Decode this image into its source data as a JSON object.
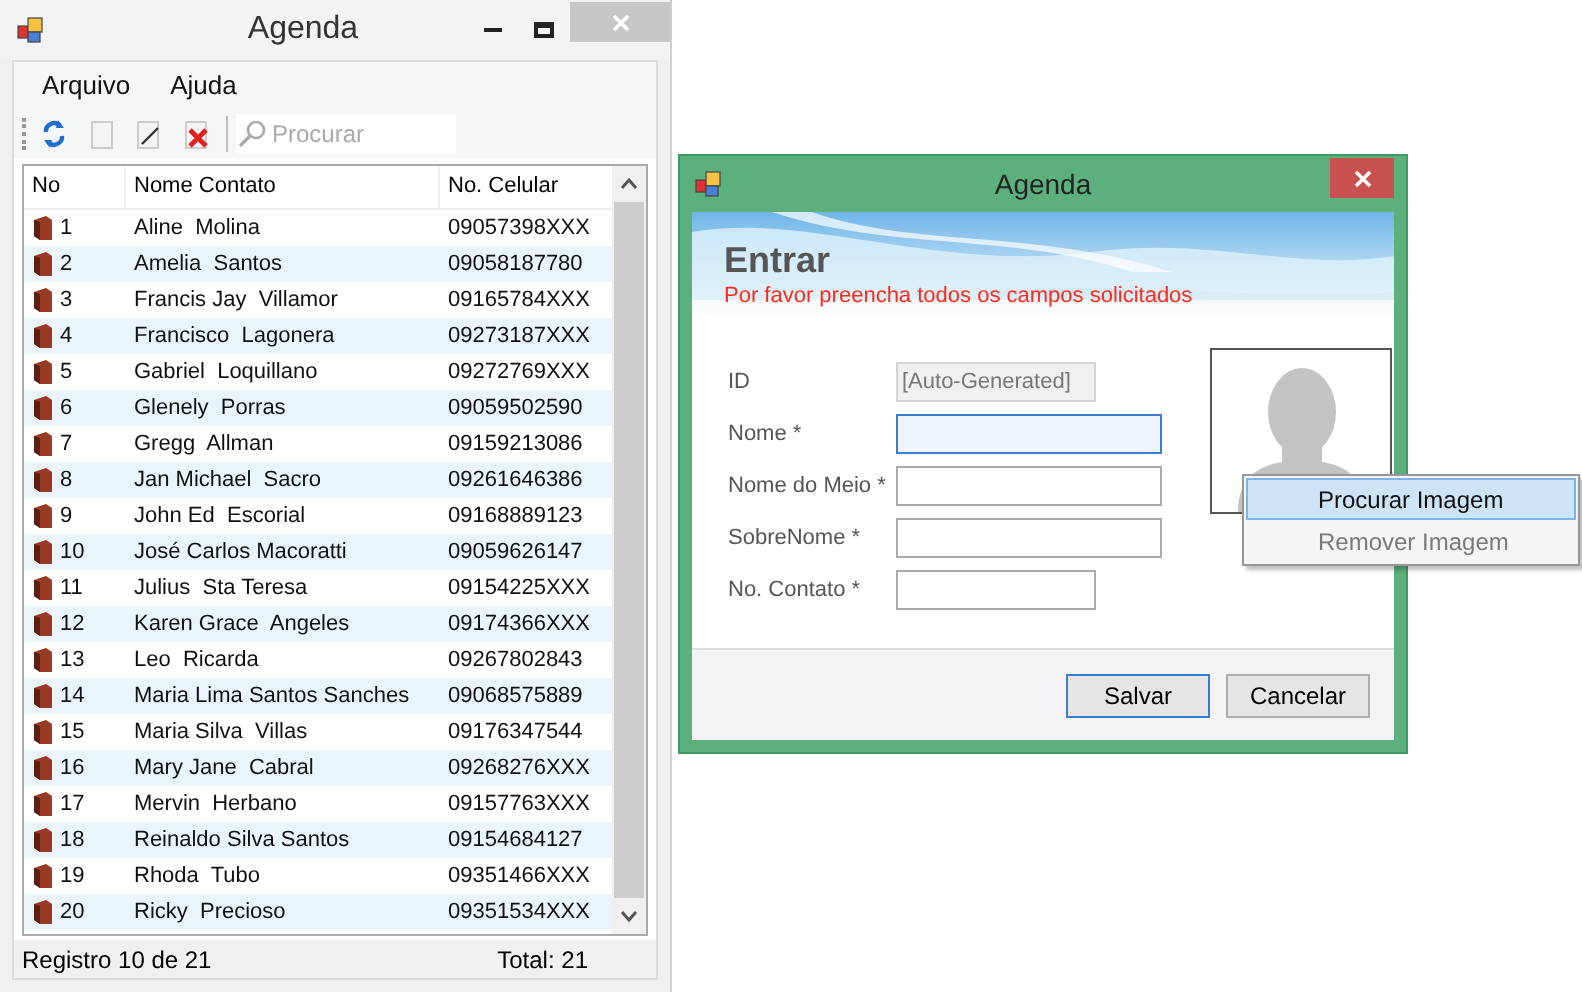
{
  "main_window": {
    "title": "Agenda",
    "menu": [
      "Arquivo",
      "Ajuda"
    ],
    "toolbar": {
      "search": {
        "placeholder": "Procurar"
      }
    },
    "table": {
      "columns": [
        "No",
        "Nome Contato",
        "No. Celular"
      ],
      "rows": [
        [
          "1",
          "Aline  Molina",
          "09057398XXX"
        ],
        [
          "2",
          "Amelia  Santos",
          "09058187780"
        ],
        [
          "3",
          "Francis Jay  Villamor",
          "09165784XXX"
        ],
        [
          "4",
          "Francisco  Lagonera",
          "09273187XXX"
        ],
        [
          "5",
          "Gabriel  Loquillano",
          "09272769XXX"
        ],
        [
          "6",
          "Glenely  Porras",
          "09059502590"
        ],
        [
          "7",
          "Gregg  Allman",
          "09159213086"
        ],
        [
          "8",
          "Jan Michael  Sacro",
          "09261646386"
        ],
        [
          "9",
          "John Ed  Escorial",
          "09168889123"
        ],
        [
          "10",
          "José Carlos Macoratti",
          "09059626147"
        ],
        [
          "11",
          "Julius  Sta Teresa",
          "09154225XXX"
        ],
        [
          "12",
          "Karen Grace  Angeles",
          "09174366XXX"
        ],
        [
          "13",
          "Leo  Ricarda",
          "09267802843"
        ],
        [
          "14",
          "Maria Lima Santos Sanches",
          "09068575889"
        ],
        [
          "15",
          "Maria Silva  Villas",
          "09176347544"
        ],
        [
          "16",
          "Mary Jane  Cabral",
          "09268276XXX"
        ],
        [
          "17",
          "Mervin  Herbano",
          "09157763XXX"
        ],
        [
          "18",
          "Reinaldo Silva Santos",
          "09154684127"
        ],
        [
          "19",
          "Rhoda  Tubo",
          "09351466XXX"
        ],
        [
          "20",
          "Ricky  Precioso",
          "09351534XXX"
        ]
      ]
    },
    "status_bar": {
      "record": "Registro 10 de 21",
      "total": "Total: 21"
    }
  },
  "dialog": {
    "title": "Agenda",
    "heading": "Entrar",
    "subtitle": "Por favor preencha todos os campos solicitados",
    "fields": [
      {
        "label": "ID",
        "value": "[Auto-Generated]",
        "disabled": true,
        "focused": false,
        "wide": false
      },
      {
        "label": "Nome *",
        "disabled": false,
        "focused": true,
        "wide": true
      },
      {
        "label": "Nome do Meio *",
        "disabled": false,
        "focused": false,
        "wide": true
      },
      {
        "label": "SobreNome *",
        "disabled": false,
        "focused": false,
        "wide": true
      },
      {
        "label": "No. Contato *",
        "disabled": false,
        "focused": false,
        "wide": false
      }
    ],
    "buttons": [
      {
        "label": "Salvar",
        "selected": true
      },
      {
        "label": "Cancelar",
        "selected": false
      }
    ]
  },
  "context_menu": [
    {
      "label": "Procurar Imagem",
      "selected": true,
      "disabled": false
    },
    {
      "label": "Remover Imagem",
      "selected": false,
      "disabled": true
    }
  ]
}
